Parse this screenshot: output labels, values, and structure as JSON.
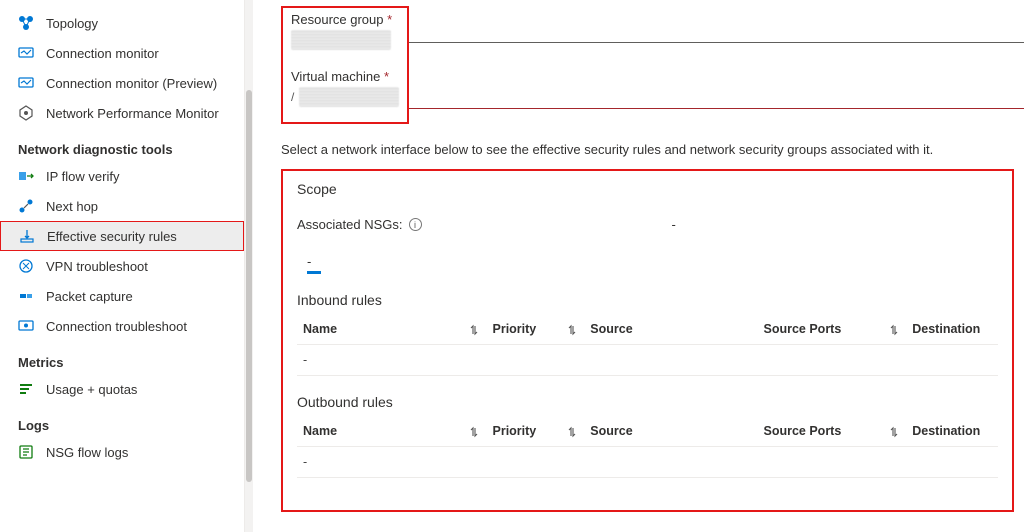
{
  "sidebar": {
    "items_top": [
      {
        "label": "Topology",
        "icon": "topology"
      },
      {
        "label": "Connection monitor",
        "icon": "monitor"
      },
      {
        "label": "Connection monitor (Preview)",
        "icon": "monitor"
      },
      {
        "label": "Network Performance Monitor",
        "icon": "npm"
      }
    ],
    "section1": "Network diagnostic tools",
    "items_diag": [
      {
        "label": "IP flow verify",
        "icon": "ipflow"
      },
      {
        "label": "Next hop",
        "icon": "nexthop"
      },
      {
        "label": "Effective security rules",
        "icon": "effective",
        "selected": true
      },
      {
        "label": "VPN troubleshoot",
        "icon": "vpn"
      },
      {
        "label": "Packet capture",
        "icon": "packet"
      },
      {
        "label": "Connection troubleshoot",
        "icon": "conntrouble"
      }
    ],
    "section2": "Metrics",
    "items_metrics": [
      {
        "label": "Usage + quotas",
        "icon": "usage"
      }
    ],
    "section3": "Logs",
    "items_logs": [
      {
        "label": "NSG flow logs",
        "icon": "nsgflow"
      }
    ]
  },
  "form": {
    "rg_label": "Resource group",
    "vm_label": "Virtual machine",
    "required": "*"
  },
  "help_text": "Select a network interface below to see the effective security rules and network security groups associated with it.",
  "scope": {
    "title": "Scope",
    "assoc_label": "Associated NSGs:",
    "dash1": "-",
    "dash_center": "-"
  },
  "tables": {
    "inbound_title": "Inbound rules",
    "outbound_title": "Outbound rules",
    "cols": {
      "name": "Name",
      "priority": "Priority",
      "source": "Source",
      "source_ports": "Source Ports",
      "destination": "Destination"
    },
    "empty": "-"
  }
}
